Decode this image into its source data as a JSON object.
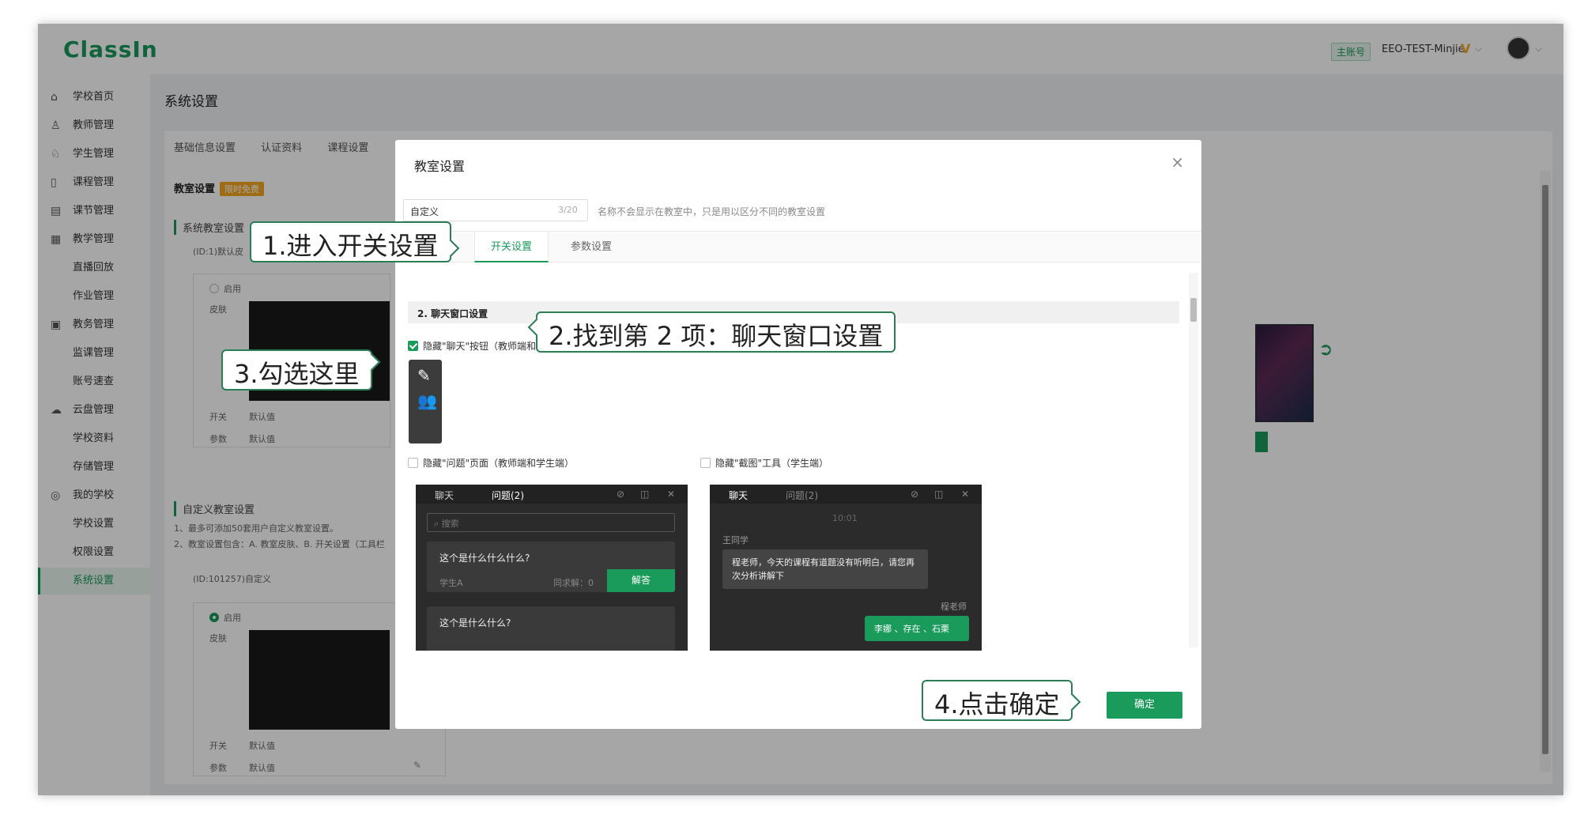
{
  "app": {
    "logo": "ClassIn"
  },
  "header": {
    "account_tag": "主账号",
    "account_name": "EEO-TEST-Minjie",
    "vip_badge": "V"
  },
  "sidebar": {
    "items": [
      {
        "label": "学校首页",
        "icon": "home-icon",
        "glyph": "⌂"
      },
      {
        "label": "教师管理",
        "icon": "user-icon",
        "glyph": "♙"
      },
      {
        "label": "学生管理",
        "icon": "users-icon",
        "glyph": "♘"
      },
      {
        "label": "课程管理",
        "icon": "book-icon",
        "glyph": "▯"
      },
      {
        "label": "课节管理",
        "icon": "calendar-icon",
        "glyph": "▤"
      },
      {
        "label": "教学管理",
        "icon": "chart-icon",
        "glyph": "▦"
      },
      {
        "label": "直播回放"
      },
      {
        "label": "作业管理"
      },
      {
        "label": "教务管理",
        "icon": "clipboard-icon",
        "glyph": "▣"
      },
      {
        "label": "监课管理"
      },
      {
        "label": "账号速查"
      },
      {
        "label": "云盘管理",
        "icon": "cloud-icon",
        "glyph": "☁"
      },
      {
        "label": "学校资料"
      },
      {
        "label": "存储管理"
      },
      {
        "label": "我的学校",
        "icon": "school-icon",
        "glyph": "◎"
      },
      {
        "label": "学校设置"
      },
      {
        "label": "权限设置"
      },
      {
        "label": "系统设置",
        "active": true
      }
    ]
  },
  "main": {
    "page_title": "系统设置",
    "tabs": [
      "基础信息设置",
      "认证资料",
      "课程设置"
    ],
    "section_title": "教室设置",
    "free_tag": "限时免费",
    "system_classroom": "系统教室设置",
    "sys_id": "(ID:1)默认皮",
    "enable_label": "启用",
    "skin_label": "皮肤",
    "switch_label": "开关",
    "switch_value": "默认值",
    "param_label": "参数",
    "param_value": "默认值",
    "custom_classroom": "自定义教室设置",
    "custom_note1": "1、最多可添加50套用户自定义教室设置。",
    "custom_note2": "2、教室设置包含：A. 教室皮肤、B. 开关设置（工具栏",
    "custom_id": "(ID:101257)自定义"
  },
  "modal": {
    "title": "教室设置",
    "name_value": "自定义",
    "name_count": "3/20",
    "name_hint": "名称不会显示在教室中，只是用以区分不同的教室设置",
    "tabs": [
      "开关设置",
      "参数设置"
    ],
    "section": "2. 聊天窗口设置",
    "options": {
      "hide_chat": "隐藏\"聊天\"按钮（教师端和学生端）",
      "hide_question": "隐藏\"问题\"页面（教师端和学生端）",
      "hide_screenshot": "隐藏\"截图\"工具（学生端）"
    },
    "question_panel": {
      "tab_chat": "聊天",
      "tab_question": "问题(2)",
      "search_placeholder": "搜索",
      "q1": "这个是什么什么什么?",
      "q1_student": "学生A",
      "q1_count": "同求解：0",
      "answer": "解答",
      "q2": "这个是什么什么?"
    },
    "chat_panel": {
      "tab_chat": "聊天",
      "tab_question": "问题(2)",
      "time": "10:01",
      "sender": "王同学",
      "message": "程老师，今天的课程有道题没有听明白，请您再次分析讲解下",
      "teacher": "程老师",
      "reply": "李娜 、存在 、石栗"
    },
    "ok_button": "确定"
  },
  "callouts": {
    "c1": "1.进入开关设置",
    "c2": "2.找到第 2 项：聊天窗口设置",
    "c3": "3.勾选这里",
    "c4": "4.点击确定"
  },
  "colors": {
    "brand": "#1a9a5b",
    "callout_border": "#2b7d55",
    "vip": "#f5a623"
  }
}
